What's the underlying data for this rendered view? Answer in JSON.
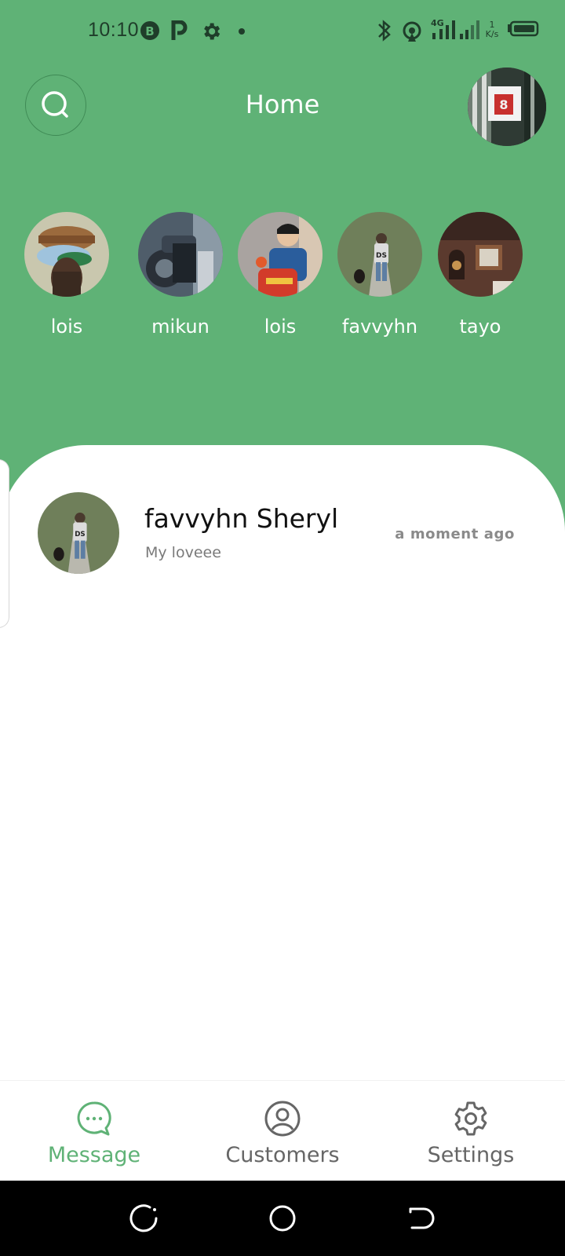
{
  "status_bar": {
    "time": "10:10",
    "icons": [
      "b-circle-icon",
      "parking-icon",
      "gear-icon",
      "dot-icon",
      "bluetooth-icon",
      "hotspot-icon",
      "signal-4g-icon",
      "signal-icon",
      "speed-icon",
      "battery-icon"
    ],
    "network_type": "4G",
    "speed_value": "1",
    "speed_unit": "K/s"
  },
  "header": {
    "title": "Home",
    "search_icon": "search-icon",
    "profile_avatar": "profile-avatar"
  },
  "stories": [
    {
      "name": "lois"
    },
    {
      "name": "mikun"
    },
    {
      "name": "lois"
    },
    {
      "name": "favvyhn"
    },
    {
      "name": "tayo"
    }
  ],
  "chats": [
    {
      "name": "favvyhn Sheryl",
      "message": "My loveee",
      "time": "a moment ago"
    }
  ],
  "bottom_nav": {
    "items": [
      {
        "label": "Message",
        "icon": "chat-bubble-icon",
        "active": true
      },
      {
        "label": "Customers",
        "icon": "user-circle-icon",
        "active": false
      },
      {
        "label": "Settings",
        "icon": "gear-icon",
        "active": false
      }
    ]
  },
  "colors": {
    "primary_green": "#5fb276",
    "active_nav": "#5fb276",
    "inactive_nav": "#666666",
    "title_text": "#ffffff"
  }
}
